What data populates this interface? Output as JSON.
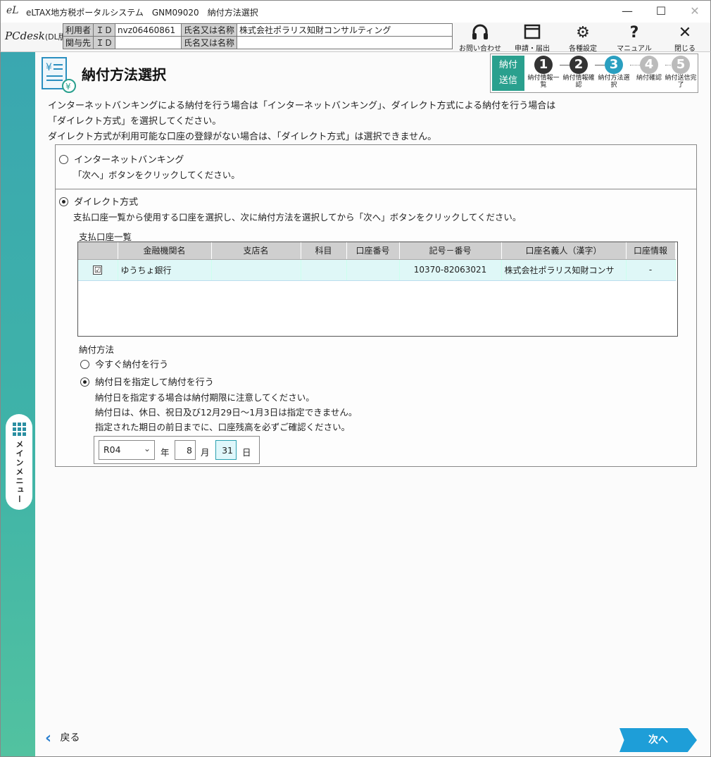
{
  "window": {
    "title": "eLTAX地方税ポータルシステム　GNM09020　納付方法選択",
    "app_icon": "eL",
    "minimize": "—",
    "maximize": "☐",
    "close": "✕"
  },
  "header": {
    "logo_main": "PCdesk",
    "logo_sub": "(DL版)",
    "user_label": "利用者",
    "id_label": "ＩＤ",
    "user_id": "nvz06460861",
    "name_label": "氏名又は名称",
    "user_name": "株式会社ポラリス知財コンサルティング",
    "related_label": "関与先",
    "related_id_label": "ＩＤ",
    "related_id": "",
    "related_name_label": "氏名又は名称",
    "related_name": "",
    "tools": [
      {
        "label": "お問い合わせ",
        "icon": "headset-icon",
        "glyph": "🎧"
      },
      {
        "label": "申請・届出",
        "icon": "window-icon",
        "glyph": "▭"
      },
      {
        "label": "各種設定",
        "icon": "gear-icon",
        "glyph": "⚙"
      },
      {
        "label": "マニュアル",
        "icon": "question-icon",
        "glyph": "?"
      },
      {
        "label": "閉じる",
        "icon": "close-icon",
        "glyph": "✕"
      }
    ]
  },
  "sidebar": {
    "main_menu_label": "メインメニュー"
  },
  "page": {
    "title": "納付方法選択",
    "steps_current": "納付\n送信",
    "steps": [
      {
        "num": "1",
        "label": "納付情報一覧",
        "color": "#333333"
      },
      {
        "num": "2",
        "label": "納付情報確認",
        "color": "#333333"
      },
      {
        "num": "3",
        "label": "納付方法選択",
        "color": "#2a9fc0"
      },
      {
        "num": "4",
        "label": "納付確認",
        "color": "#bbbbbb"
      },
      {
        "num": "5",
        "label": "納付送信完了",
        "color": "#bbbbbb"
      }
    ],
    "intro_line1": "インターネットバンキングによる納付を行う場合は「インターネットバンキング」、ダイレクト方式による納付を行う場合は",
    "intro_line2": "「ダイレクト方式」を選択してください。",
    "intro_line3": "ダイレクト方式が利用可能な口座の登録がない場合は、「ダイレクト方式」は選択できません。"
  },
  "options": {
    "internet_banking_label": "インターネットバンキング",
    "internet_banking_desc": "「次へ」ボタンをクリックしてください。",
    "direct_label": "ダイレクト方式",
    "direct_desc": "支払口座一覧から使用する口座を選択し、次に納付方法を選択してから「次へ」ボタンをクリックしてください。",
    "account_list_label": "支払口座一覧"
  },
  "accounts": {
    "columns": [
      "",
      "金融機関名",
      "支店名",
      "科目",
      "口座番号",
      "記号－番号",
      "口座名義人（漢字）",
      "口座情報"
    ],
    "rows": [
      {
        "checked": "☑",
        "bank": "ゆうちょ銀行",
        "branch": "",
        "type": "",
        "number": "",
        "symbol_number": "10370-82063021",
        "holder": "株式会社ポラリス知財コンサ",
        "info": "-"
      }
    ]
  },
  "payment": {
    "method_label": "納付方法",
    "now_label": "今すぐ納付を行う",
    "scheduled_label": "納付日を指定して納付を行う",
    "note1": "納付日を指定する場合は納付期限に注意してください。",
    "note2": "納付日は、休日、祝日及び12月29日～1月3日は指定できません。",
    "note3": "指定された期日の前日までに、口座残高を必ずご確認ください。",
    "era": "R04",
    "year_unit": "年",
    "month": "8",
    "month_unit": "月",
    "day": "31",
    "day_unit": "日"
  },
  "footer": {
    "back_label": "戻る",
    "next_label": "次へ"
  }
}
